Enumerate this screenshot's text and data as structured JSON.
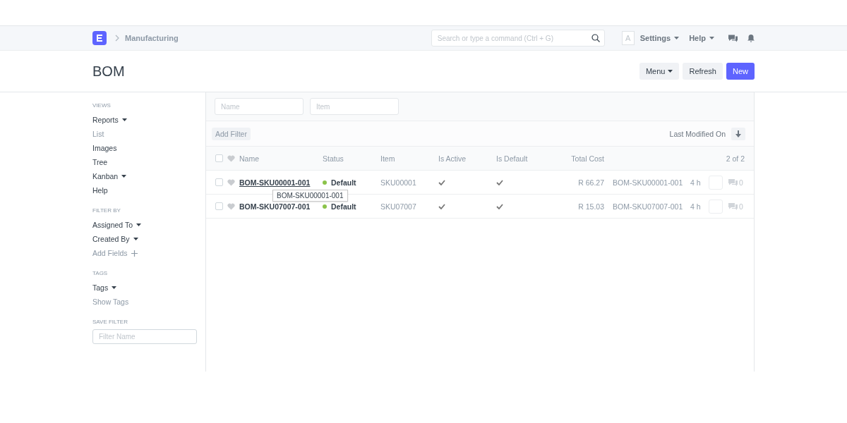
{
  "navbar": {
    "breadcrumb": "Manufacturing",
    "search": {
      "placeholder": "Search or type a command (Ctrl + G)"
    },
    "avatar": "A",
    "menus": [
      "Settings",
      "Help"
    ]
  },
  "page": {
    "title": "BOM",
    "buttons": [
      {
        "label": "Menu",
        "kind": "dropdown"
      },
      {
        "label": "Refresh",
        "kind": "default"
      },
      {
        "label": "New",
        "kind": "primary"
      }
    ]
  },
  "sidebar": {
    "sections": [
      {
        "heading": "VIEWS",
        "items": [
          {
            "label": "Reports",
            "kind": "dropdown"
          },
          {
            "label": "List",
            "kind": "muted"
          },
          {
            "label": "Images",
            "kind": "link"
          },
          {
            "label": "Tree",
            "kind": "link"
          },
          {
            "label": "Kanban",
            "kind": "dropdown"
          },
          {
            "label": "Help",
            "kind": "link"
          }
        ]
      },
      {
        "heading": "FILTER BY",
        "items": [
          {
            "label": "Assigned To",
            "kind": "dropdown"
          },
          {
            "label": "Created By",
            "kind": "dropdown"
          },
          {
            "label": "Add Fields",
            "kind": "add"
          }
        ]
      },
      {
        "heading": "TAGS",
        "items": [
          {
            "label": "Tags",
            "kind": "dropdown"
          },
          {
            "label": "Show Tags",
            "kind": "muted"
          }
        ]
      },
      {
        "heading": "SAVE FILTER",
        "field": {
          "placeholder": "Filter Name"
        }
      }
    ]
  },
  "filters": {
    "fields": [
      {
        "placeholder": "Name"
      },
      {
        "placeholder": "Item"
      }
    ],
    "add_filter": "Add Filter",
    "sort": "Last Modified On"
  },
  "table": {
    "columns": [
      "Name",
      "Status",
      "Item",
      "Is Active",
      "Is Default",
      "Total Cost"
    ],
    "count": "2 of 2",
    "all_checked": false,
    "rows": [
      {
        "checked": false,
        "liked": false,
        "name": "BOM-SKU00001-001",
        "hovered": true,
        "status": "Default",
        "color": "#8bc34a",
        "item": "SKU00001",
        "is_active": true,
        "is_default": true,
        "total_cost": "R 66.27",
        "title": "BOM-SKU00001-001",
        "modified": "4 h",
        "comments": "0"
      },
      {
        "checked": false,
        "liked": false,
        "name": "BOM-SKU07007-001",
        "hovered": false,
        "status": "Default",
        "color": "#8bc34a",
        "item": "SKU07007",
        "is_active": true,
        "is_default": true,
        "total_cost": "R 15.03",
        "title": "BOM-SKU07007-001",
        "modified": "4 h",
        "comments": "0"
      }
    ]
  },
  "tooltip": "BOM-SKU00001-001"
}
